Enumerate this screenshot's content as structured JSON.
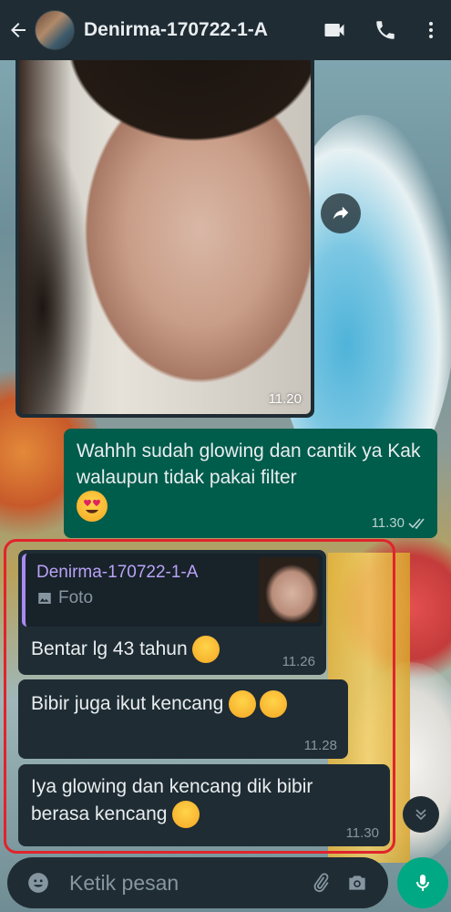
{
  "header": {
    "title": "Denirma-170722-1-A",
    "icons": [
      "back-arrow-icon",
      "video-call-icon",
      "phone-icon",
      "more-vert-icon"
    ]
  },
  "messages": {
    "photo": {
      "time": "11.20"
    },
    "outgoing": {
      "text": "Wahhh sudah glowing dan cantik ya Kak walaupun tidak pakai filter",
      "emoji": "heart-eyes",
      "time": "11.30"
    },
    "incoming": [
      {
        "quote_name": "Denirma-170722-1-A",
        "quote_type": "Foto",
        "text": "Bentar lg 43 tahun",
        "emoji": "smiling-face",
        "time": "11.26"
      },
      {
        "text": "Bibir juga ikut kencang",
        "emoji": "smiling-face",
        "time": "11.28"
      },
      {
        "text": "Iya glowing dan kencang dik bibir berasa kencang",
        "emoji": "partying-face",
        "time": "11.30"
      }
    ]
  },
  "composer": {
    "placeholder": "Ketik pesan"
  },
  "colors": {
    "header": "#1f2c34",
    "outgoing_bubble": "#005c4b",
    "incoming_bubble": "#1f2c34",
    "highlight": "#e0242c",
    "accent": "#00a884"
  }
}
